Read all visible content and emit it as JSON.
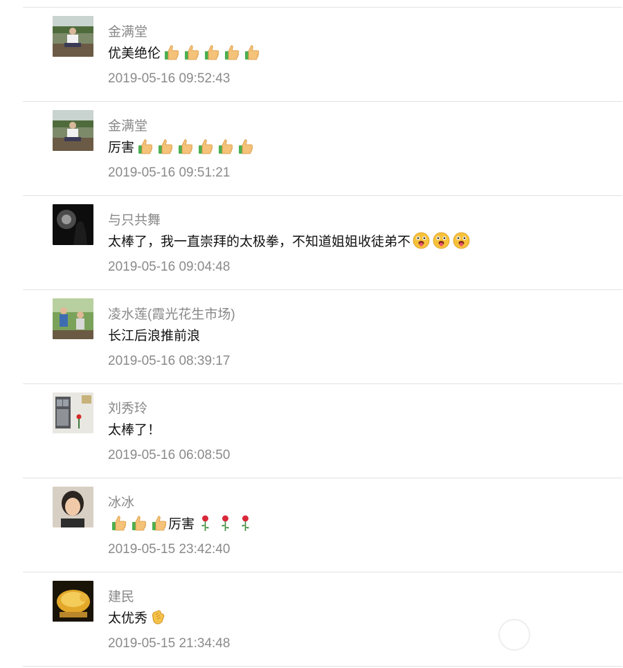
{
  "comments": [
    {
      "name": "金满堂",
      "text": "优美绝伦",
      "emojis": [
        "thumbs-up-icon",
        "thumbs-up-icon",
        "thumbs-up-icon",
        "thumbs-up-icon",
        "thumbs-up-icon"
      ],
      "time": "2019-05-16 09:52:43",
      "avatar": "man-sitting-outdoors"
    },
    {
      "name": "金满堂",
      "text": "厉害",
      "emojis": [
        "thumbs-up-icon",
        "thumbs-up-icon",
        "thumbs-up-icon",
        "thumbs-up-icon",
        "thumbs-up-icon",
        "thumbs-up-icon"
      ],
      "time": "2019-05-16 09:51:21",
      "avatar": "man-sitting-outdoors"
    },
    {
      "name": "与只共舞",
      "text": "太棒了，我一直崇拜的太极拳，不知道姐姐收徒弟不",
      "emojis": [
        "tongue-face-icon",
        "tongue-face-icon",
        "tongue-face-icon"
      ],
      "time": "2019-05-16 09:04:48",
      "avatar": "dark-silhouette"
    },
    {
      "name": "凌水莲(霞光花生市场)",
      "text": "长江后浪推前浪",
      "emojis": [],
      "time": "2019-05-16 08:39:17",
      "avatar": "children-outdoors"
    },
    {
      "name": "刘秀玲",
      "text": "太棒了！",
      "emojis": [],
      "time": "2019-05-16 06:08:50",
      "avatar": "room-interior"
    },
    {
      "name": "冰冰",
      "text": "厉害",
      "emojis_before": [
        "thumbs-up-icon",
        "thumbs-up-icon",
        "thumbs-up-icon"
      ],
      "emojis": [
        "rose-icon",
        "rose-icon",
        "rose-icon"
      ],
      "time": "2019-05-15 23:42:40",
      "avatar": "woman-portrait"
    },
    {
      "name": "建民",
      "text": "太优秀",
      "emojis": [
        "clap-hands-icon"
      ],
      "time": "2019-05-15 21:34:48",
      "avatar": "golden-pig"
    }
  ],
  "colors": {
    "name": "#888888",
    "time": "#8a8a8a",
    "divider": "#e2e2e2"
  }
}
